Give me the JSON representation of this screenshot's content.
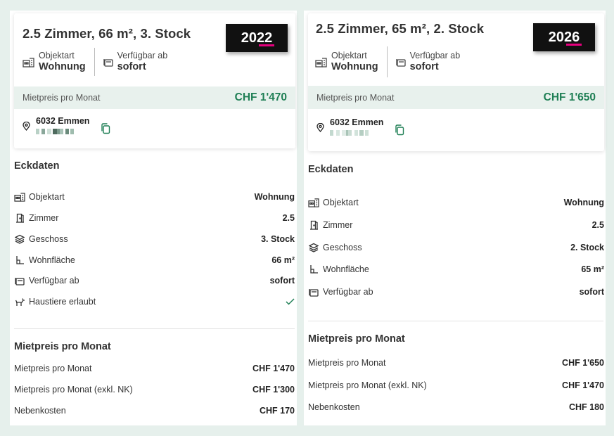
{
  "listings": [
    {
      "title": "2.5 Zimmer, 66 m², 3. Stock",
      "year": "2022",
      "meta": [
        {
          "label": "Objektart",
          "value": "Wohnung",
          "icon": "building-icon"
        },
        {
          "label": "Verfügbar ab",
          "value": "sofort",
          "icon": "calendar-icon"
        }
      ],
      "price_bar": {
        "label": "Mietpreis pro Monat",
        "value": "CHF 1'470"
      },
      "address": {
        "city": "6032 Emmen"
      },
      "eckdaten_title": "Eckdaten",
      "eckdaten": [
        {
          "label": "Objektart",
          "value": "Wohnung",
          "icon": "building-icon"
        },
        {
          "label": "Zimmer",
          "value": "2.5",
          "icon": "door-icon"
        },
        {
          "label": "Geschoss",
          "value": "3. Stock",
          "icon": "layers-icon"
        },
        {
          "label": "Wohnfläche",
          "value": "66 m²",
          "icon": "area-icon"
        },
        {
          "label": "Verfügbar ab",
          "value": "sofort",
          "icon": "calendar-icon"
        },
        {
          "label": "Haustiere erlaubt",
          "value": "",
          "icon": "pet-icon",
          "check": true
        }
      ],
      "price_title": "Mietpreis pro Monat",
      "prices": [
        {
          "label": "Mietpreis pro Monat",
          "value": "CHF 1'470"
        },
        {
          "label": "Mietpreis pro Monat (exkl. NK)",
          "value": "CHF 1'300"
        },
        {
          "label": "Nebenkosten",
          "value": "CHF 170"
        }
      ]
    },
    {
      "title": "2.5 Zimmer, 65 m², 2. Stock",
      "year": "2026",
      "meta": [
        {
          "label": "Objektart",
          "value": "Wohnung",
          "icon": "building-icon"
        },
        {
          "label": "Verfügbar ab",
          "value": "sofort",
          "icon": "calendar-icon"
        }
      ],
      "price_bar": {
        "label": "Mietpreis pro Monat",
        "value": "CHF 1'650"
      },
      "address": {
        "city": "6032 Emmen"
      },
      "eckdaten_title": "Eckdaten",
      "eckdaten": [
        {
          "label": "Objektart",
          "value": "Wohnung",
          "icon": "building-icon"
        },
        {
          "label": "Zimmer",
          "value": "2.5",
          "icon": "door-icon"
        },
        {
          "label": "Geschoss",
          "value": "2. Stock",
          "icon": "layers-icon"
        },
        {
          "label": "Wohnfläche",
          "value": "65 m²",
          "icon": "area-icon"
        },
        {
          "label": "Verfügbar ab",
          "value": "sofort",
          "icon": "calendar-icon"
        }
      ],
      "price_title": "Mietpreis pro Monat",
      "prices": [
        {
          "label": "Mietpreis pro Monat",
          "value": "CHF 1'650"
        },
        {
          "label": "Mietpreis pro Monat (exkl. NK)",
          "value": "CHF 1'470"
        },
        {
          "label": "Nebenkosten",
          "value": "CHF 180"
        }
      ]
    }
  ],
  "colors": {
    "accent_green": "#1f7f55",
    "price_bar_bg": "#e8f1ed",
    "badge_bg": "#111111",
    "badge_underline": "#e6007e"
  }
}
